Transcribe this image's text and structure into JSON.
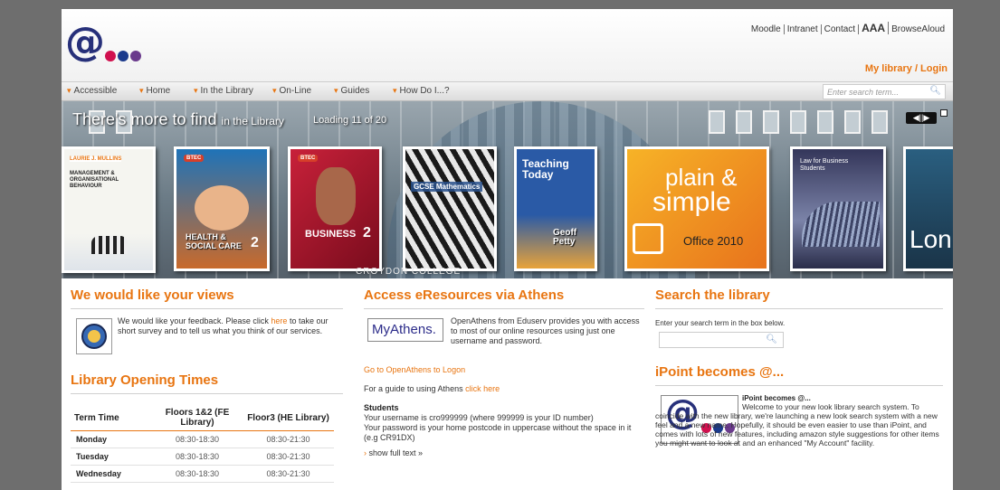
{
  "header": {
    "logo_at": "@",
    "dot_colors": [
      "#d0104e",
      "#1b3a8c",
      "#6a3a8c"
    ],
    "toplinks": [
      "Moodle",
      "Intranet",
      "Contact",
      "AAA",
      "BrowseAloud"
    ],
    "my_library": "My library / Login"
  },
  "nav": {
    "items": [
      "Accessible",
      "Home",
      "In the Library",
      "On-Line",
      "Guides",
      "How Do I...?"
    ],
    "search_placeholder": "Enter search term...",
    "search_icon": "search-icon"
  },
  "carousel": {
    "title": "There's more to find",
    "title_suffix": "in the Library",
    "status": "Loading 11 of 20",
    "controls": "◀||▶",
    "caption": "CROYDON COLLEGE",
    "books": [
      {
        "author": "LAURIE J. MULLINS",
        "title": "MANAGEMENT & ORGANISATIONAL BEHAVIOUR"
      },
      {
        "badge": "BTEC",
        "title": "HEALTH & SOCIAL CARE",
        "number": "2"
      },
      {
        "badge": "BTEC",
        "title": "BUSINESS",
        "number": "2"
      },
      {
        "title": "GCSE Mathematics"
      },
      {
        "title": "Teaching Today",
        "author": "Geoff Petty"
      },
      {
        "title_a": "plain &",
        "title_b": "simple",
        "product": "Office 2010"
      },
      {
        "title": "Law for Business Students"
      },
      {
        "title": "Lon"
      }
    ]
  },
  "views": {
    "heading": "We would like your views",
    "text_pre": "We would like your feedback. Please click ",
    "link": "here",
    "text_post": " to take our short survey and to tell us what you think of our services."
  },
  "hours": {
    "heading": "Library Opening Times",
    "columns": [
      "Term Time",
      "Floors 1&2 (FE Library)",
      "Floor3 (HE Library)"
    ],
    "rows": [
      {
        "day": "Monday",
        "fe": "08:30-18:30",
        "he": "08:30-21:30"
      },
      {
        "day": "Tuesday",
        "fe": "08:30-18:30",
        "he": "08:30-21:30"
      },
      {
        "day": "Wednesday",
        "fe": "08:30-18:30",
        "he": "08:30-21:30"
      }
    ]
  },
  "athens": {
    "heading": "Access eResources via Athens",
    "logo": "MyAthens.",
    "intro": "OpenAthens from Eduserv provides you with access to most of our online resources using just one username and password.",
    "logon_link": "Go to OpenAthens to Logon",
    "guide_pre": "For a guide to using Athens ",
    "guide_link": "click here",
    "students_heading": "Students",
    "students_line1": "Your username is cro999999 (where 999999 is your ID number)",
    "students_line2": "Your password is your home postcode in uppercase without the space in it (e.g CR91DX)",
    "show_full": "show full text »"
  },
  "search": {
    "heading": "Search the library",
    "hint": "Enter your search term in the box below."
  },
  "ipoint": {
    "heading": "iPoint becomes @...",
    "title": "iPoint becomes @...",
    "text": "Welcome to your new look library search system. To coincide with the new library, we're launching a new look search system with a new feel and a new name. Hopefully, it should be even easier to use than iPoint, and comes with lots of new features, including amazon style suggestions for other items you might want to look at and an enhanced \"My Account\" facility."
  },
  "colors": {
    "accent": "#e87511",
    "brand": "#27307a"
  }
}
